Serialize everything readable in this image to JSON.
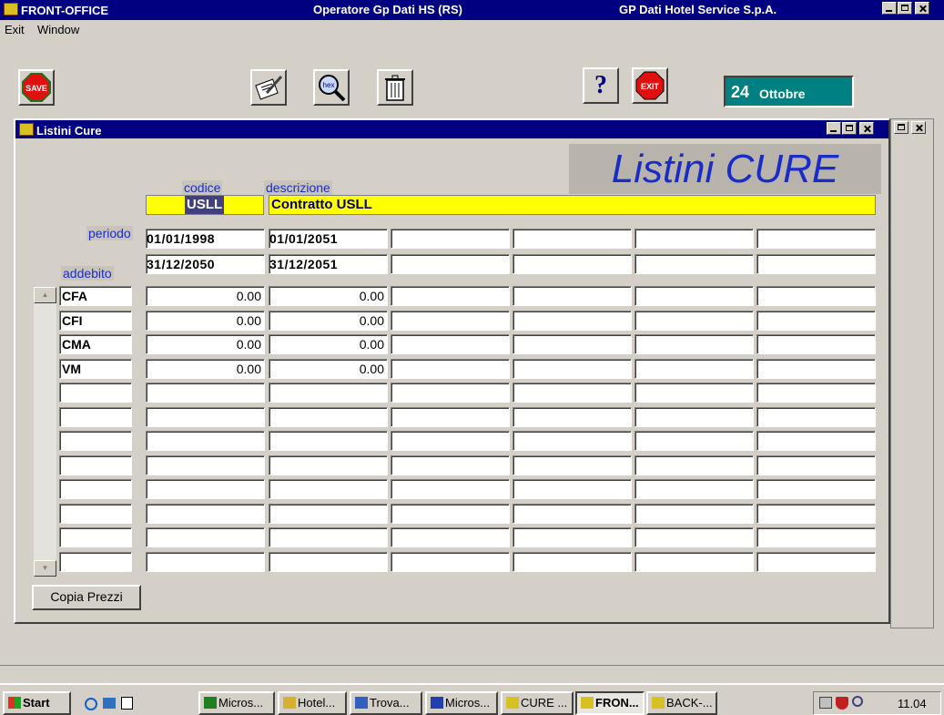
{
  "window": {
    "app_title": "FRONT-OFFICE",
    "operator": "Operatore Gp Dati HS (RS)",
    "company": "GP Dati Hotel Service S.p.A."
  },
  "menu": {
    "exit": "Exit",
    "window": "Window"
  },
  "toolbar": {
    "save": "SAVE",
    "hex": "hex",
    "help": "?",
    "exit": "EXIT",
    "date_day": "24",
    "date_month": "Ottobre"
  },
  "child": {
    "title": "Listini Cure",
    "heading": "Listini CURE"
  },
  "form": {
    "codice_label": "codice",
    "descrizione_label": "descrizione",
    "codice": "USLL",
    "descrizione": "Contratto USLL",
    "periodo_label": "periodo",
    "addebito_label": "addebito",
    "period_from": [
      "01/01/1998",
      "01/01/2051",
      "",
      "",
      "",
      ""
    ],
    "period_to": [
      "31/12/2050",
      "31/12/2051",
      "",
      "",
      "",
      ""
    ],
    "rows": [
      {
        "code": "CFA",
        "prices": [
          "0.00",
          "0.00",
          "",
          "",
          "",
          ""
        ]
      },
      {
        "code": "CFI",
        "prices": [
          "0.00",
          "0.00",
          "",
          "",
          "",
          ""
        ]
      },
      {
        "code": "CMA",
        "prices": [
          "0.00",
          "0.00",
          "",
          "",
          "",
          ""
        ]
      },
      {
        "code": "VM",
        "prices": [
          "0.00",
          "0.00",
          "",
          "",
          "",
          ""
        ]
      },
      {
        "code": "",
        "prices": [
          "",
          "",
          "",
          "",
          "",
          ""
        ]
      },
      {
        "code": "",
        "prices": [
          "",
          "",
          "",
          "",
          "",
          ""
        ]
      },
      {
        "code": "",
        "prices": [
          "",
          "",
          "",
          "",
          "",
          ""
        ]
      },
      {
        "code": "",
        "prices": [
          "",
          "",
          "",
          "",
          "",
          ""
        ]
      },
      {
        "code": "",
        "prices": [
          "",
          "",
          "",
          "",
          "",
          ""
        ]
      },
      {
        "code": "",
        "prices": [
          "",
          "",
          "",
          "",
          "",
          ""
        ]
      },
      {
        "code": "",
        "prices": [
          "",
          "",
          "",
          "",
          "",
          ""
        ]
      },
      {
        "code": "",
        "prices": [
          "",
          "",
          "",
          "",
          "",
          ""
        ]
      }
    ],
    "copy_button": "Copia Prezzi"
  },
  "taskbar": {
    "start": "Start",
    "tasks": [
      "Micros...",
      "Hotel...",
      "Trova...",
      "Micros...",
      "CURE ...",
      "FRON...",
      "BACK-..."
    ],
    "clock": "11.04"
  }
}
